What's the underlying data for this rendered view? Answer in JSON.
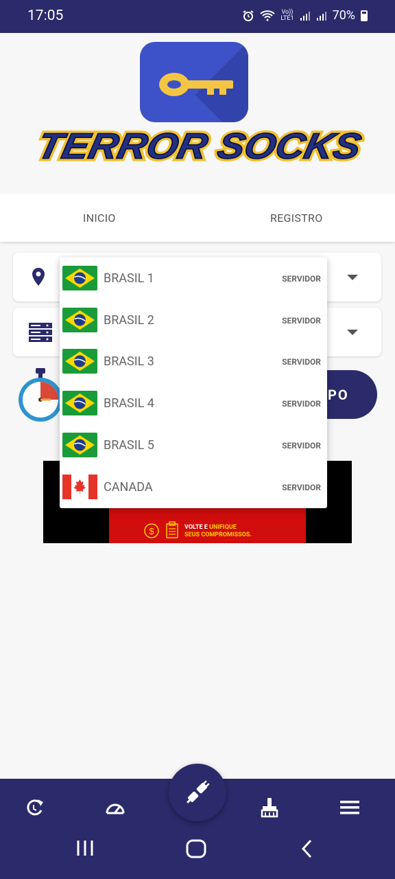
{
  "status_bar": {
    "time": "17:05",
    "network_label_top": "Vo))",
    "network_label_bottom": "LTE1",
    "battery": "70%",
    "icons": [
      "alarm-icon",
      "wifi-icon",
      "signal-icon",
      "battery-icon"
    ]
  },
  "header": {
    "app_icon": "key-icon",
    "brand_text": "TERROR SOCKS"
  },
  "tabs": [
    {
      "label": "INICIO"
    },
    {
      "label": "REGISTRO"
    }
  ],
  "selectors": {
    "location_icon": "location-pin-icon",
    "server_icon": "server-stack-icon"
  },
  "connect_button": {
    "label_visible": "PO"
  },
  "ad": {
    "line1_white": "VOLTE E ",
    "line1_yellow": "UNIFIQUE",
    "line2": "SEUS COMPROMISSOS."
  },
  "dropdown": {
    "items": [
      {
        "name": "BRASIL 1",
        "type": "SERVIDOR",
        "flag": "brazil"
      },
      {
        "name": "BRASIL 2",
        "type": "SERVIDOR",
        "flag": "brazil"
      },
      {
        "name": "BRASIL 3",
        "type": "SERVIDOR",
        "flag": "brazil"
      },
      {
        "name": "BRASIL 4",
        "type": "SERVIDOR",
        "flag": "brazil"
      },
      {
        "name": "BRASIL 5",
        "type": "SERVIDOR",
        "flag": "brazil"
      },
      {
        "name": "CANADA",
        "type": "SERVIDOR",
        "flag": "canada"
      }
    ]
  },
  "bottom_nav": {
    "items": [
      "refresh-icon",
      "speedometer-icon",
      "plug-icon",
      "cleaner-brush-icon",
      "menu-icon"
    ]
  },
  "colors": {
    "primary": "#2b2a6b",
    "brazil_green": "#1a9b3a",
    "brazil_yellow": "#f8d800",
    "brazil_blue": "#1f3c8a",
    "canada_red": "#e5332a"
  }
}
